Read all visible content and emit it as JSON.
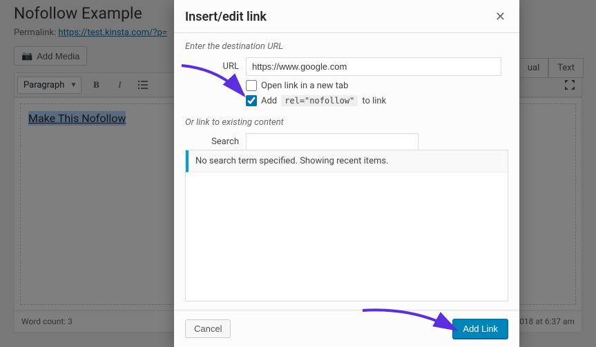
{
  "post": {
    "title": "Nofollow Example",
    "permalink_label": "Permalink:",
    "permalink_url": "https://test.kinsta.com/?p=",
    "add_media": "Add Media",
    "paragraph_label": "Paragraph",
    "content_selected": "Make This Nofollow",
    "word_count_label": "Word count: 3",
    "draft_saved": "018 at 6:37 am"
  },
  "tabs": {
    "visual": "ual",
    "text": "Text"
  },
  "modal": {
    "title": "Insert/edit link",
    "section_destination": "Enter the destination URL",
    "url_label": "URL",
    "url_value": "https://www.google.com",
    "newtab_label": "Open link in a new tab",
    "nofollow_prefix": "Add",
    "nofollow_code": "rel=\"nofollow\"",
    "nofollow_suffix": "to link",
    "section_existing": "Or link to existing content",
    "search_label": "Search",
    "search_placeholder": "",
    "results_notice": "No search term specified. Showing recent items.",
    "cancel": "Cancel",
    "submit": "Add Link"
  }
}
